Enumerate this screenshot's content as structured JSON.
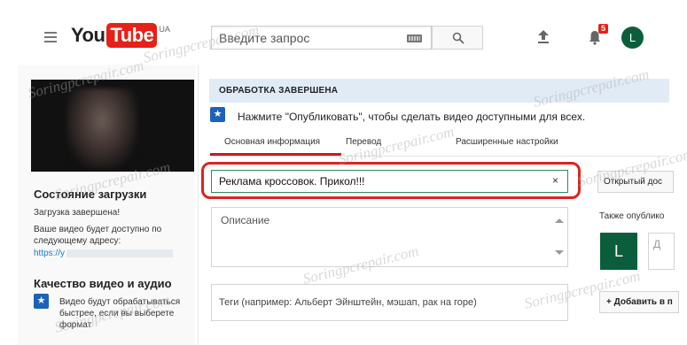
{
  "header": {
    "logo_you": "You",
    "logo_tube": "Tube",
    "logo_region": "UA",
    "search_placeholder": "Введите запрос",
    "notification_count": "5",
    "avatar_letter": "L"
  },
  "left": {
    "upload_status_title": "Состояние загрузки",
    "upload_status_text": "Загрузка завершена!",
    "available_text": "Ваше видео будет доступно по следующему адресу:",
    "link_prefix": "https://y",
    "quality_title": "Качество видео и аудио",
    "quality_text": "Видео будут обрабатываться быстрее, если вы выберете формат"
  },
  "main": {
    "banner": "ОБРАБОТКА ЗАВЕРШЕНА",
    "info_text": "Нажмите \"Опубликовать\", чтобы сделать видео доступными для всех.",
    "tabs": [
      {
        "label": "Основная информация"
      },
      {
        "label": "Перевод"
      },
      {
        "label": "Расширенные настройки"
      }
    ],
    "title_value": "Реклама кроссовок. Прикол!!!",
    "clear_symbol": "×",
    "description_placeholder": "Описание",
    "tags_placeholder": "Теги (например: Альберт Эйнштейн, мэшап, рак на горе)"
  },
  "right": {
    "privacy": "Открытый дос",
    "also_publish": "Также опублико",
    "share_avatar_letter": "L",
    "share_text": "Д",
    "add_button": "+ Добавить в п"
  },
  "watermark": "Soringpcrepair.com",
  "colors": {
    "accent_red": "#cc181e",
    "highlight_red": "#d9251d",
    "info_blue": "#1c62b9",
    "banner_blue": "#e1ebf6",
    "avatar_green": "#0b5e3c"
  }
}
